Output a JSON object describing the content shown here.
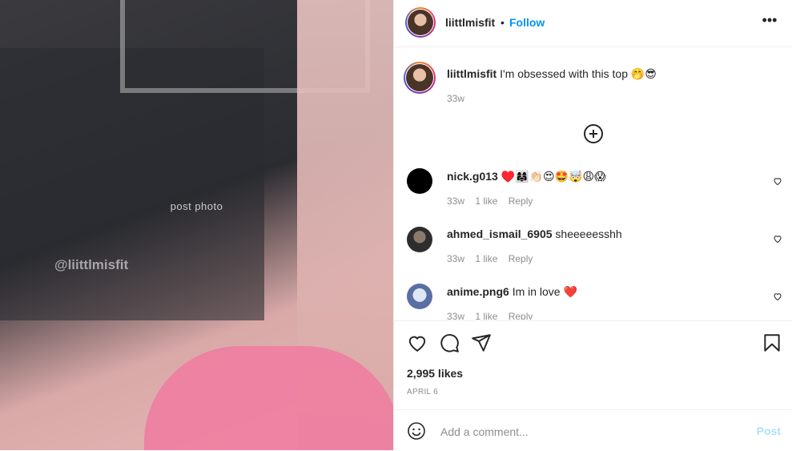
{
  "post": {
    "image_watermark": "@liittlmisfit",
    "image_placeholder": "post photo",
    "author": "liittlmisfit",
    "follow_label": "Follow",
    "separator": "•",
    "more_label": "•••",
    "caption_user": "liittlmisfit",
    "caption_text": "I'm obsessed with this top 🤭😎",
    "caption_age": "33w"
  },
  "comments": [
    {
      "user": "nick.g013",
      "text": "♥️👩‍👩‍👧👏🏻😍🤩🤯😩😱",
      "age": "33w",
      "likes": "1 like",
      "reply": "Reply"
    },
    {
      "user": "ahmed_ismail_6905",
      "text": "sheeeeesshh",
      "age": "33w",
      "likes": "1 like",
      "reply": "Reply"
    },
    {
      "user": "anime.png6",
      "text": "Im in love ❤️",
      "age": "33w",
      "likes": "1 like",
      "reply": "Reply"
    }
  ],
  "stats": {
    "likes": "2,995 likes",
    "date": "APRIL 6"
  },
  "composer": {
    "placeholder": "Add a comment...",
    "post_label": "Post"
  },
  "colors": {
    "link": "#0095f6",
    "post_disabled": "#b2dffc",
    "muted": "#8e8e8e",
    "border": "#efefef"
  },
  "icons": [
    "more-icon",
    "add-comments-icon",
    "like-icon",
    "comment-icon",
    "share-icon",
    "save-icon",
    "emoji-icon",
    "comment-like-icon"
  ]
}
